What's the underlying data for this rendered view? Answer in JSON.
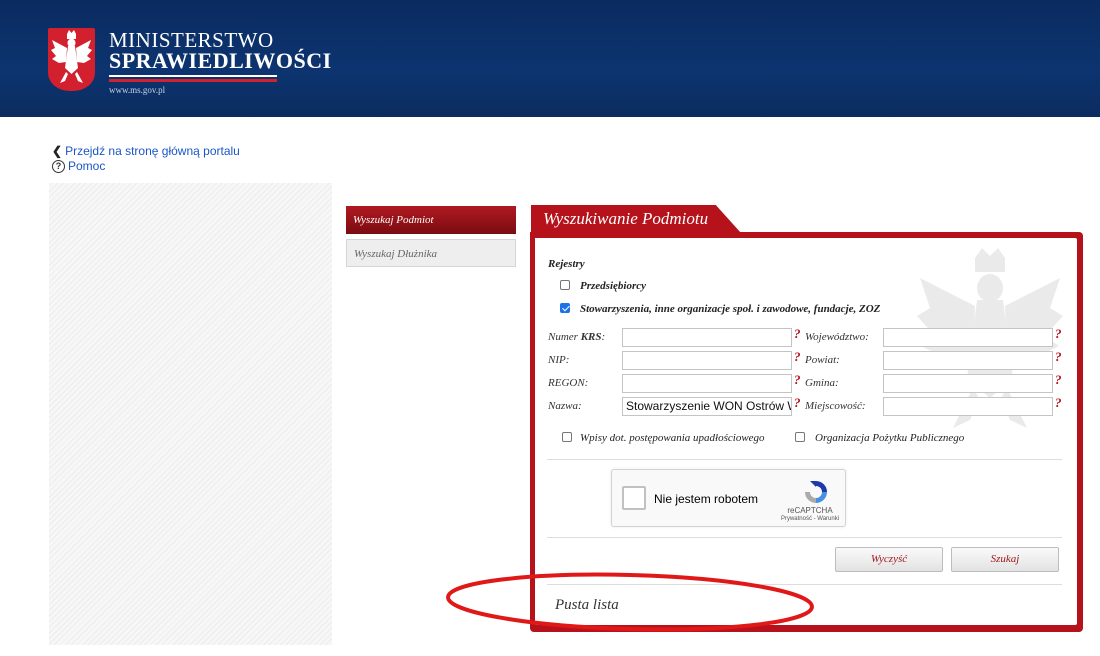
{
  "header": {
    "line1": "MINISTERSTWO",
    "line2": "SPRAWIEDLIWOŚCI",
    "url": "www.ms.gov.pl"
  },
  "links": {
    "back": "Przejdź na stronę główną portalu",
    "help": "Pomoc"
  },
  "menu": {
    "items": [
      {
        "label": "Wyszukaj Podmiot",
        "active": true
      },
      {
        "label": "Wyszukaj Dłużnika",
        "active": false
      }
    ]
  },
  "panel": {
    "tab_title": "Wyszukiwanie Podmiotu",
    "rejestry_label": "Rejestry",
    "registers": [
      {
        "label": "Przedsiębiorcy",
        "checked": false
      },
      {
        "label": "Stowarzyszenia, inne organizacje społ. i zawodowe, fundacje, ZOZ",
        "checked": true
      }
    ],
    "fields_left": [
      {
        "label_prefix": "Numer ",
        "label_bold": "KRS",
        "label_suffix": ":",
        "value": ""
      },
      {
        "label_prefix": "NIP:",
        "label_bold": "",
        "label_suffix": "",
        "value": ""
      },
      {
        "label_prefix": "REGON:",
        "label_bold": "",
        "label_suffix": "",
        "value": ""
      },
      {
        "label_prefix": "Nazwa:",
        "label_bold": "",
        "label_suffix": "",
        "value": "Stowarzyszenie WON Ostrów Wie"
      }
    ],
    "fields_right": [
      {
        "label": "Województwo:",
        "value": ""
      },
      {
        "label": "Powiat:",
        "value": ""
      },
      {
        "label": "Gmina:",
        "value": ""
      },
      {
        "label": "Miejscowość:",
        "value": ""
      }
    ],
    "help_mark": "?",
    "options": [
      {
        "label": "Wpisy dot. postępowania upadłościowego",
        "checked": false
      },
      {
        "label": "Organizacja Pożytku Publicznego",
        "checked": false
      }
    ],
    "captcha": {
      "label": "Nie jestem robotem",
      "brand": "reCAPTCHA",
      "links": "Prywatność - Warunki"
    },
    "buttons": {
      "clear": "Wyczyść",
      "search": "Szukaj"
    },
    "result_text": "Pusta lista"
  },
  "colors": {
    "header_bg": "#0d3470",
    "accent_red": "#b5121b",
    "link_blue": "#1a56c9"
  }
}
